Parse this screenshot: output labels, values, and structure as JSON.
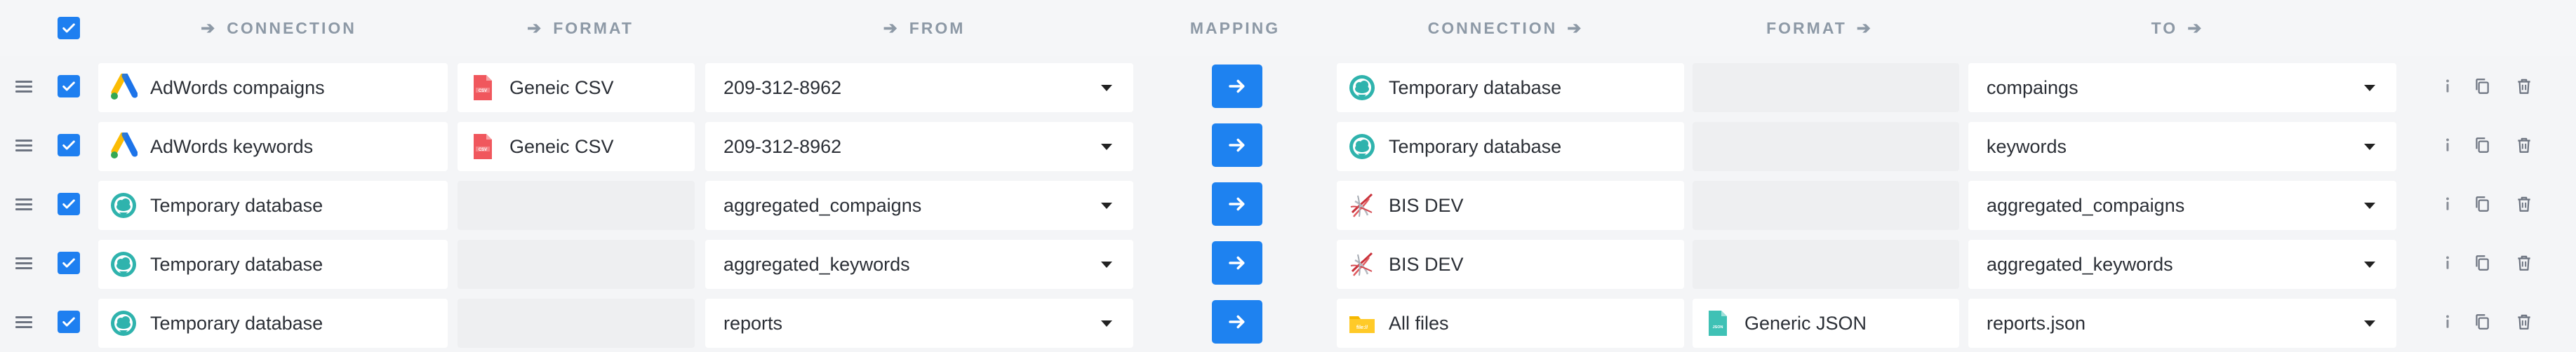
{
  "header": {
    "select_all_checked": true,
    "columns": {
      "source_connection": "CONNECTION",
      "source_format": "FORMAT",
      "from": "FROM",
      "mapping": "MAPPING",
      "target_connection": "CONNECTION",
      "target_format": "FORMAT",
      "to": "TO"
    }
  },
  "rows": [
    {
      "checked": true,
      "source_connection": {
        "label": "AdWords compaigns",
        "icon": "adwords-icon"
      },
      "source_format": {
        "label": "Geneic CSV",
        "icon": "csv-file-icon"
      },
      "from": "209-312-8962",
      "target_connection": {
        "label": "Temporary database",
        "icon": "temp-database-icon"
      },
      "target_format": {
        "label": "",
        "icon": ""
      },
      "to": "compaings"
    },
    {
      "checked": true,
      "source_connection": {
        "label": "AdWords keywords",
        "icon": "adwords-icon"
      },
      "source_format": {
        "label": "Geneic CSV",
        "icon": "csv-file-icon"
      },
      "from": "209-312-8962",
      "target_connection": {
        "label": "Temporary database",
        "icon": "temp-database-icon"
      },
      "target_format": {
        "label": "",
        "icon": ""
      },
      "to": "keywords"
    },
    {
      "checked": true,
      "source_connection": {
        "label": "Temporary database",
        "icon": "temp-database-icon"
      },
      "source_format": {
        "label": "",
        "icon": ""
      },
      "from": "aggregated_compaigns",
      "target_connection": {
        "label": "BIS DEV",
        "icon": "sql-server-icon"
      },
      "target_format": {
        "label": "",
        "icon": ""
      },
      "to": "aggregated_compaigns"
    },
    {
      "checked": true,
      "source_connection": {
        "label": "Temporary database",
        "icon": "temp-database-icon"
      },
      "source_format": {
        "label": "",
        "icon": ""
      },
      "from": "aggregated_keywords",
      "target_connection": {
        "label": "BIS DEV",
        "icon": "sql-server-icon"
      },
      "target_format": {
        "label": "",
        "icon": ""
      },
      "to": "aggregated_keywords"
    },
    {
      "checked": true,
      "source_connection": {
        "label": "Temporary database",
        "icon": "temp-database-icon"
      },
      "source_format": {
        "label": "",
        "icon": ""
      },
      "from": "reports",
      "target_connection": {
        "label": "All files",
        "icon": "folder-files-icon"
      },
      "target_format": {
        "label": "Generic JSON",
        "icon": "json-file-icon"
      },
      "to": "reports.json"
    }
  ],
  "icon_labels": {
    "csv": "CSV",
    "json": "JSON",
    "files": "file://"
  },
  "colors": {
    "accent": "#1e82f0",
    "checkbox": "#1e7ff0",
    "header_text": "#8d99a6",
    "empty_cell": "#eeeff1"
  }
}
